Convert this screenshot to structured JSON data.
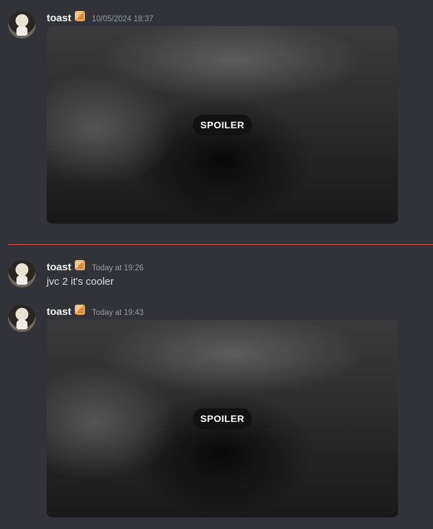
{
  "messages": [
    {
      "author": "toast",
      "author_icon": "orange-box-emoji",
      "timestamp": "10/05/2024 18:37",
      "attachment": {
        "type": "image",
        "spoiler_label": "SPOILER"
      }
    },
    {
      "author": "toast",
      "author_icon": "orange-box-emoji",
      "timestamp": "Today at 19:26",
      "text": "jvc 2 it's cooler"
    },
    {
      "author": "toast",
      "author_icon": "orange-box-emoji",
      "timestamp": "Today at 19:43",
      "attachment": {
        "type": "image",
        "spoiler_label": "SPOILER"
      }
    }
  ],
  "colors": {
    "background": "#313338",
    "new_messages_divider": "#e25252",
    "author": "#f2f3f5",
    "timestamp": "#949ba4",
    "message_text": "#dbdee1"
  }
}
